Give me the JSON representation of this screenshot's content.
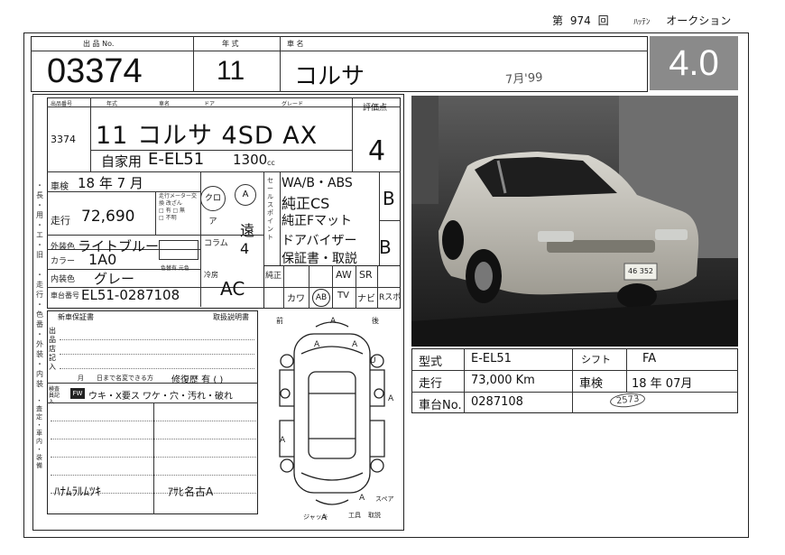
{
  "header": {
    "session_prefix": "第",
    "session_number": "974",
    "session_suffix": "回",
    "brand": "ﾊｯﾃﾝ",
    "event": "オークション"
  },
  "top_row": {
    "lot_label": "出 品 No.",
    "lot_number": "03374",
    "year_label": "年 式",
    "year": "11",
    "model_label": "車 名",
    "model": "コルサ",
    "date_stamp": "7月'99",
    "score": "4.0"
  },
  "sheet": {
    "lot_small_label": "出品番号",
    "lot_small": "3374",
    "year_label": "年式",
    "name_label": "車名",
    "door_label": "ドア",
    "grade_label": "グレード",
    "score_label": "評価点",
    "line1": "11 コルサ 4SD  AX",
    "score_hand": "4",
    "usage": "自家用",
    "model_code": "E-EL51",
    "displacement": "1300",
    "cc_label": "cc",
    "inspection_label": "車検",
    "inspection": "18 年  7 月",
    "mileage_label": "走行",
    "mileage": "72,690",
    "color_ext_label": "外装色",
    "color_ext": "ライトブルー",
    "color_code_label": "カラー",
    "color_code": "1A0",
    "color_int_label": "内装色",
    "color_int": "グレー",
    "chassis_label": "車台番号",
    "chassis": "EL51-0287108",
    "column_label": "コラム",
    "column_mark": "クロア",
    "ac_label": "冷房",
    "ac": "AC",
    "options": [
      "WA/B・ABS",
      "純正CS",
      "純正Fマット",
      "ドアバイザー",
      "保証書・取説"
    ],
    "interior_grade": "B",
    "exterior_grade": "B",
    "equipment": [
      "純正",
      "AW",
      "SR",
      "カワ",
      "AB",
      "TV",
      "ナビ",
      "Rスポ"
    ],
    "notes_title": "新車保証書",
    "notes_sub": "出品店記入",
    "record_title": "取扱説明書",
    "repair_row": "修復歴  有 (   )",
    "defects_label": "ウキ・X要ス  ワケ・穴・汚れ・破れ",
    "sign_left": "ﾊﾅﾑﾗﾙﾑﾂｷ",
    "sign_right": "ｱｻﾋ名古A",
    "diagram_labels": {
      "front": "前",
      "rear": "後",
      "jack": "ジャッキ",
      "tools": "工具",
      "manual": "取説",
      "spare": "スペア"
    }
  },
  "photo": {
    "caption": "Silver Toyota Corsa sedan",
    "plate": "46 352"
  },
  "spec_table": {
    "rows": [
      {
        "l1": "型式",
        "v1": "E-EL51",
        "l2": "シフト",
        "v2": "FA"
      },
      {
        "l1": "走行",
        "v1": "73,000  Km",
        "l2": "車検",
        "v2": "18  年  07月"
      },
      {
        "l1": "車台No.",
        "v1": "0287108",
        "l2": "",
        "v2": "2573"
      }
    ]
  }
}
